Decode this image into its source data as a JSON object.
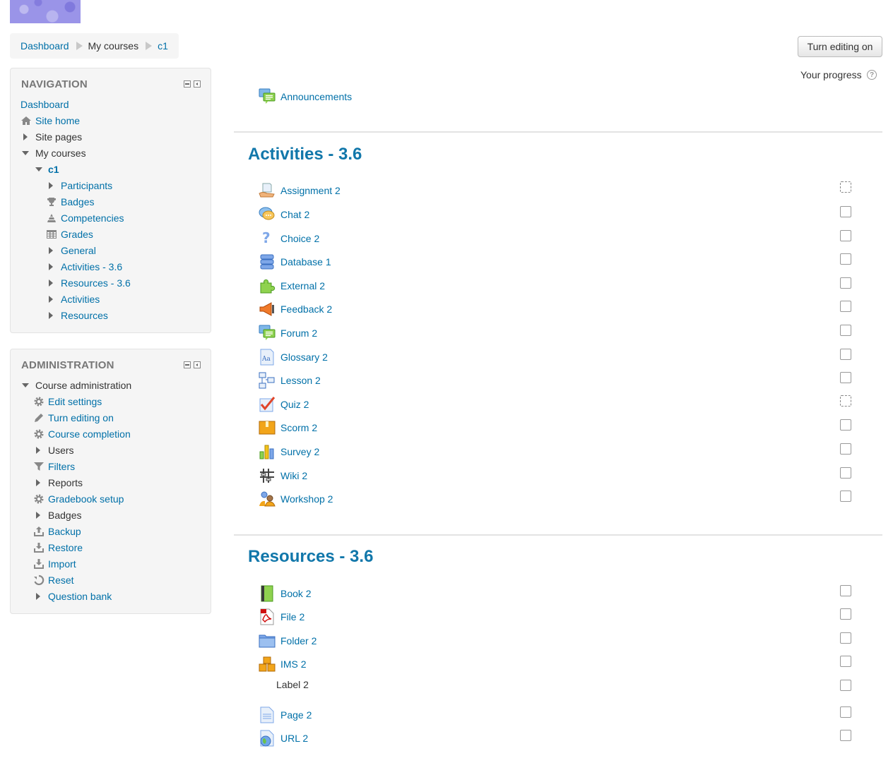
{
  "breadcrumb": {
    "dashboard": "Dashboard",
    "my_courses": "My courses",
    "course": "c1"
  },
  "header": {
    "editing_button": "Turn editing on",
    "progress_label": "Your progress",
    "help_icon": "?"
  },
  "navigation": {
    "title": "NAVIGATION",
    "dashboard": "Dashboard",
    "site_home": "Site home",
    "site_pages": "Site pages",
    "my_courses": "My courses",
    "course": "c1",
    "participants": "Participants",
    "badges": "Badges",
    "competencies": "Competencies",
    "grades": "Grades",
    "general": "General",
    "activities_36": "Activities - 3.6",
    "resources_36": "Resources - 3.6",
    "activities": "Activities",
    "resources": "Resources"
  },
  "administration": {
    "title": "ADMINISTRATION",
    "course_admin": "Course administration",
    "edit_settings": "Edit settings",
    "turn_editing_on": "Turn editing on",
    "course_completion": "Course completion",
    "users": "Users",
    "filters": "Filters",
    "reports": "Reports",
    "gradebook_setup": "Gradebook setup",
    "badges": "Badges",
    "backup": "Backup",
    "restore": "Restore",
    "import": "Import",
    "reset": "Reset",
    "question_bank": "Question bank"
  },
  "general_section": {
    "announcements": "Announcements"
  },
  "activities_section": {
    "title": "Activities - 3.6",
    "items": [
      "Assignment 2",
      "Chat 2",
      "Choice 2",
      "Database 1",
      "External 2",
      "Feedback 2",
      "Forum 2",
      "Glossary 2",
      "Lesson 2",
      "Quiz 2",
      "Scorm 2",
      "Survey 2",
      "Wiki 2",
      "Workshop 2"
    ]
  },
  "resources_section": {
    "title": "Resources - 3.6",
    "items": [
      "Book 2",
      "File 2",
      "Folder 2",
      "IMS 2",
      "Label 2",
      "Page 2",
      "URL 2"
    ]
  },
  "colors": {
    "link": "#0070a8",
    "section_title": "#1177aa",
    "block_bg": "#f5f5f5"
  }
}
